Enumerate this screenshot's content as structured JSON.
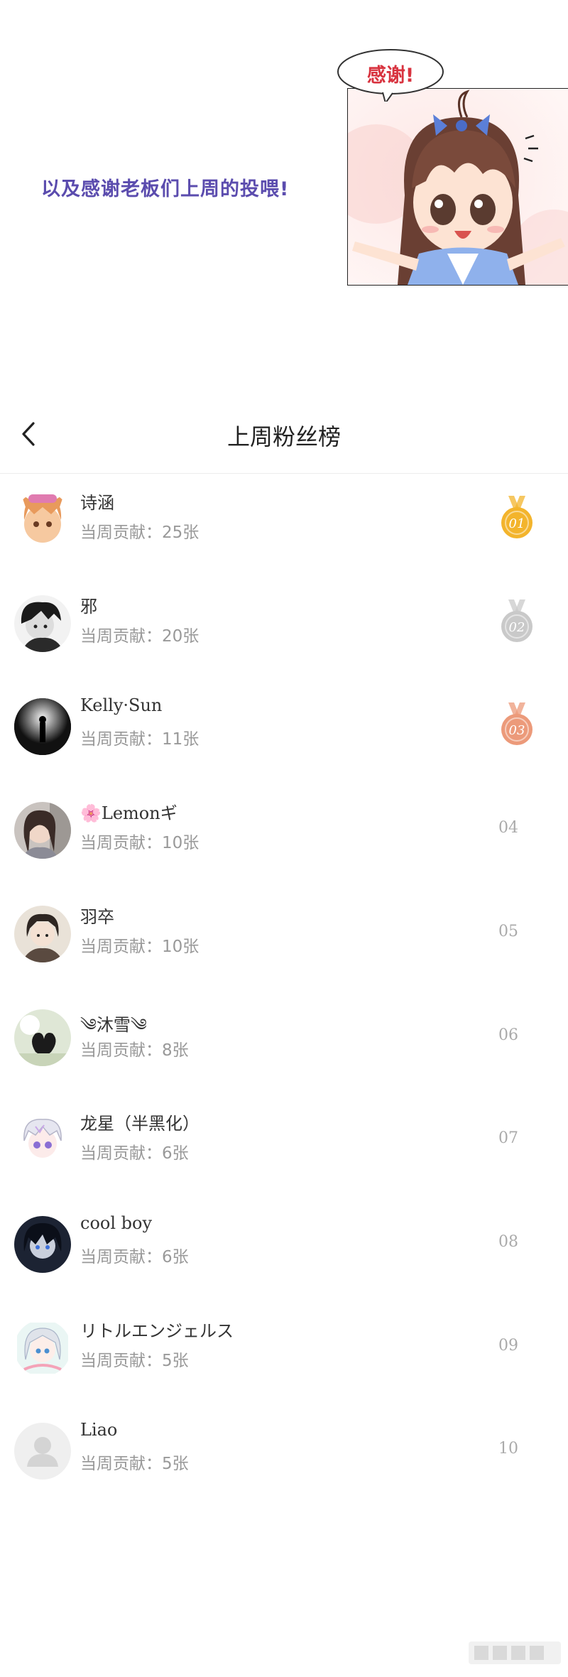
{
  "banner": {
    "thanks_line": "以及感谢老板们上周的投喂!",
    "bubble_text": "感谢!"
  },
  "header": {
    "title": "上周粉丝榜",
    "back_icon": "chevron-left-icon"
  },
  "contribution_prefix": "当周贡献:",
  "fans": [
    {
      "rank": "01",
      "name": "诗涵",
      "contribution": "当周贡献：25张",
      "medal": "gold",
      "medal_color": "#f3b42c"
    },
    {
      "rank": "02",
      "name": "邪",
      "contribution": "当周贡献：20张",
      "medal": "silver",
      "medal_color": "#c9c9c9"
    },
    {
      "rank": "03",
      "name": "Kelly·Sun",
      "contribution": "当周贡献：11张",
      "medal": "bronze",
      "medal_color": "#ec9a7a"
    },
    {
      "rank": "04",
      "name": "🌸Lemonギ",
      "contribution": "当周贡献：10张"
    },
    {
      "rank": "05",
      "name": "羽卒",
      "contribution": "当周贡献：10张"
    },
    {
      "rank": "06",
      "name": "༄沐雪༄",
      "contribution": "当周贡献：8张"
    },
    {
      "rank": "07",
      "name": "龙星（半黑化）",
      "contribution": "当周贡献：6张"
    },
    {
      "rank": "08",
      "name": "cool boy",
      "contribution": "当周贡献：6张"
    },
    {
      "rank": "09",
      "name": "リトルエンジェルス",
      "contribution": "当周贡献：5张"
    },
    {
      "rank": "10",
      "name": "Liao",
      "contribution": "当周贡献：5张"
    }
  ],
  "colors": {
    "accent_purple": "#5b4cae",
    "bubble_red": "#d8333f",
    "gold": "#f3b42c",
    "silver": "#c9c9c9",
    "bronze": "#ec9a7a"
  }
}
